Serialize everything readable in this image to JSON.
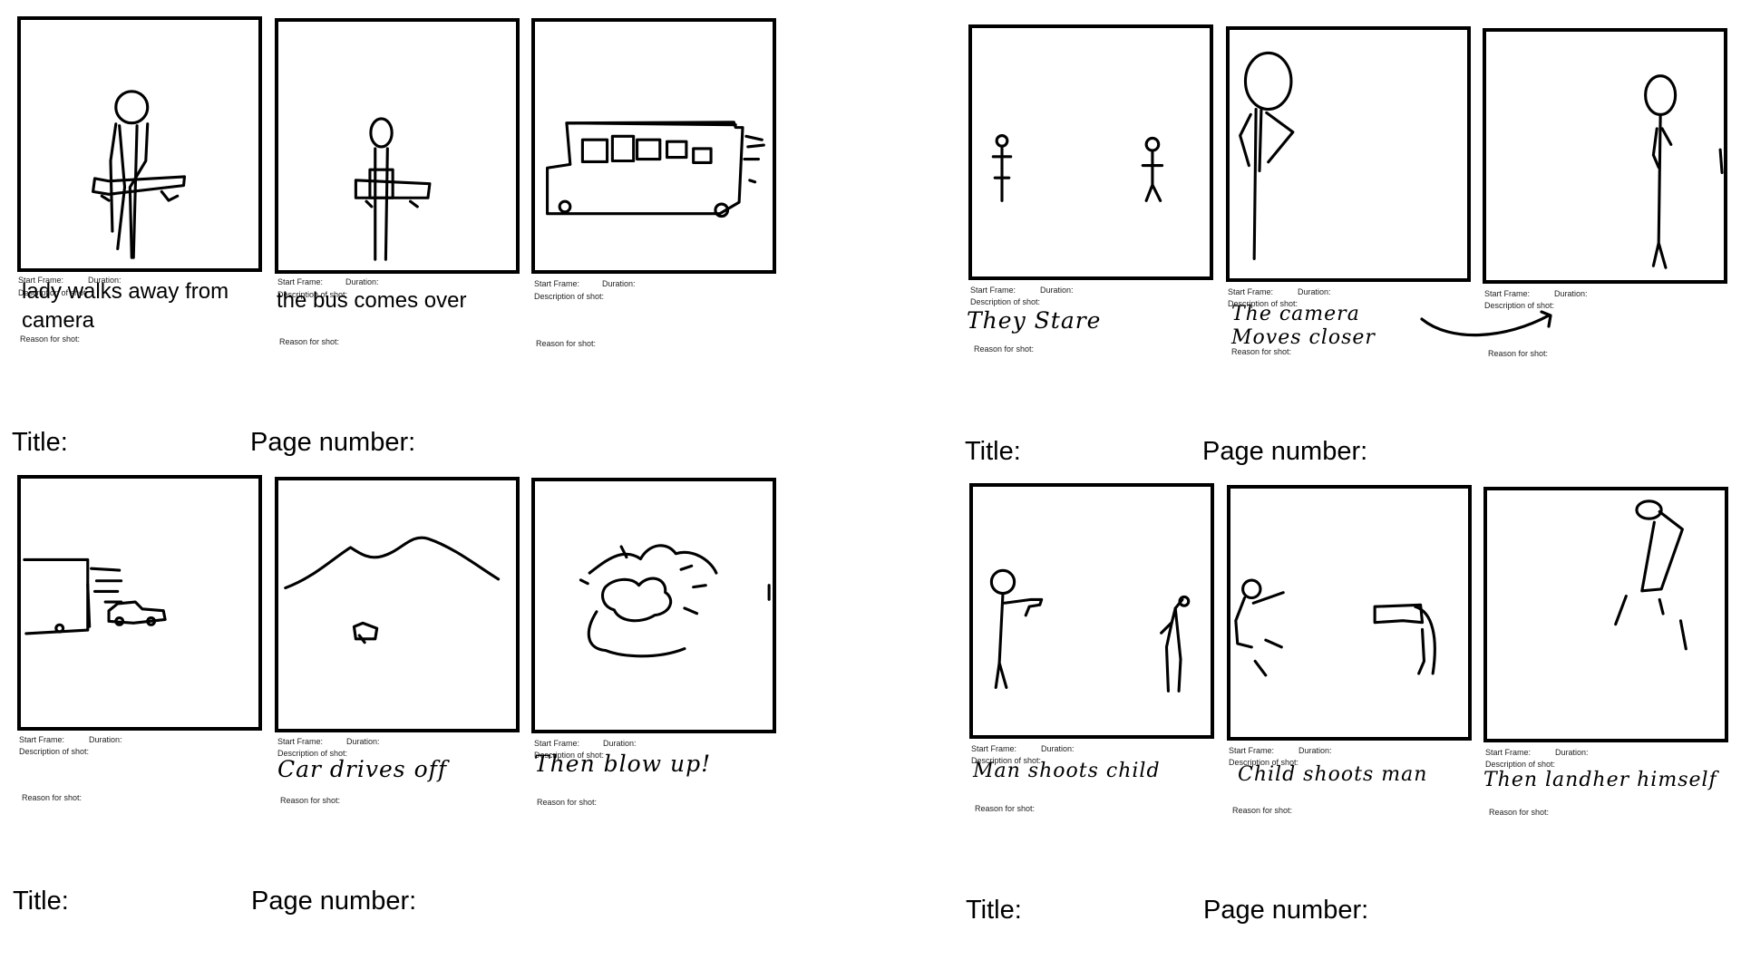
{
  "labels": {
    "start_frame": "Start Frame:",
    "duration": "Duration:",
    "description": "Description of shot:",
    "reason": "Reason for shot:",
    "title": "Title:",
    "page_number": "Page number:"
  },
  "sheets": [
    {
      "panels": [
        {
          "description": "lady walks away from camera",
          "picture": "woman-walking-away-sketch"
        },
        {
          "description": "the bus comes over",
          "picture": "figure-with-bus-sketch"
        },
        {
          "description": "",
          "picture": "bus-sketch"
        }
      ]
    },
    {
      "panels": [
        {
          "description": "They Stare",
          "picture": "two-stick-figures-sketch"
        },
        {
          "description": "The camera Moves closer",
          "picture": "closeup-figure-sketch"
        },
        {
          "description": "",
          "picture": "standing-figure-sketch"
        }
      ]
    },
    {
      "panels": [
        {
          "description": "",
          "picture": "truck-and-car-sketch"
        },
        {
          "description": "Car drives off",
          "picture": "car-under-mountain-sketch"
        },
        {
          "description": "Then blow up!",
          "picture": "explosion-sketch"
        }
      ]
    },
    {
      "panels": [
        {
          "description": "Man shoots child",
          "picture": "man-shoots-child-sketch"
        },
        {
          "description": "Child shoots man",
          "picture": "child-shoots-man-sketch"
        },
        {
          "description": "Then landher himself",
          "picture": "falling-figure-sketch"
        }
      ]
    }
  ]
}
